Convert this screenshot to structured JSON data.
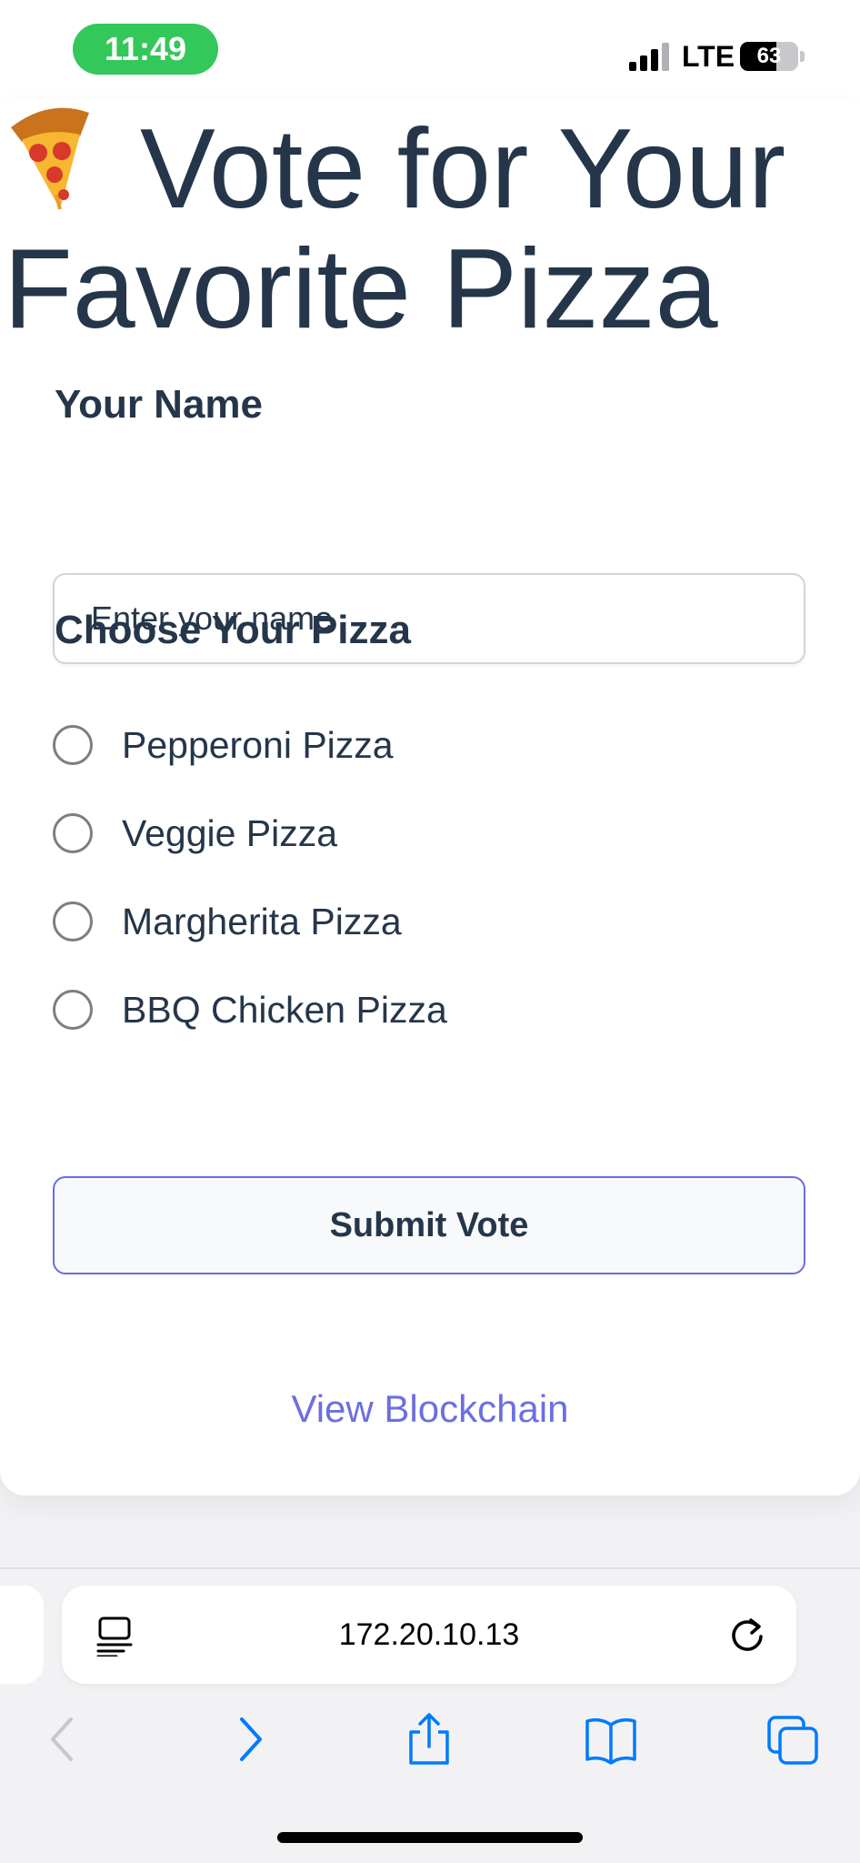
{
  "status_bar": {
    "time": "11:49",
    "network": "LTE",
    "battery_level": "63",
    "battery_fraction": 0.63,
    "time_pill_color": "#34c759"
  },
  "page": {
    "title_line1": "Vote for Your",
    "title_line2": "Favorite Pizza",
    "title_icon": "pizza-slice-icon",
    "name_label": "Your Name",
    "name_placeholder": "Enter your name",
    "name_value": "",
    "choose_label": "Choose Your Pizza",
    "options": [
      {
        "label": "Pepperoni Pizza",
        "selected": false
      },
      {
        "label": "Veggie Pizza",
        "selected": false
      },
      {
        "label": "Margherita Pizza",
        "selected": false
      },
      {
        "label": "BBQ Chicken Pizza",
        "selected": false
      }
    ],
    "submit_label": "Submit Vote",
    "view_link_label": "View Blockchain",
    "text_color": "#25364a",
    "accent_color": "#6b6fe0"
  },
  "browser": {
    "url": "172.20.10.13",
    "page_menu_icon": "page-menu-icon",
    "reload_icon": "reload-icon",
    "toolbar_icons": [
      "back-icon",
      "forward-icon",
      "share-icon",
      "bookmarks-icon",
      "tabs-icon"
    ],
    "toolbar_color": "#007aff"
  }
}
